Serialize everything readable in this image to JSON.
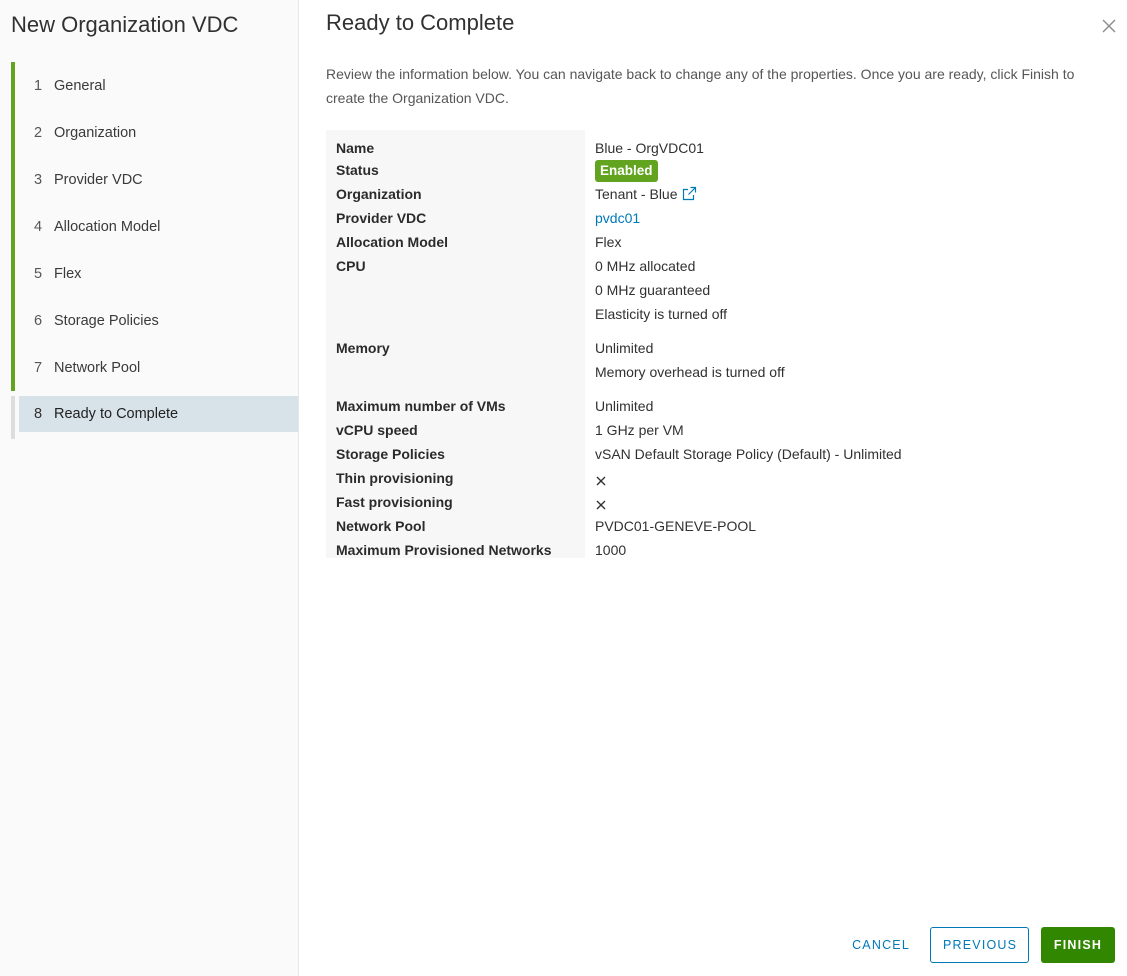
{
  "wizard": {
    "title": "New Organization VDC",
    "steps": [
      {
        "num": "1",
        "label": "General"
      },
      {
        "num": "2",
        "label": "Organization"
      },
      {
        "num": "3",
        "label": "Provider VDC"
      },
      {
        "num": "4",
        "label": "Allocation Model"
      },
      {
        "num": "5",
        "label": "Flex"
      },
      {
        "num": "6",
        "label": "Storage Policies"
      },
      {
        "num": "7",
        "label": "Network Pool"
      },
      {
        "num": "8",
        "label": "Ready to Complete"
      }
    ],
    "active_step": 8
  },
  "page": {
    "title": "Ready to Complete",
    "intro": "Review the information below. You can navigate back to change any of the properties. Once you are ready, click Finish to create the Organization VDC."
  },
  "summary": {
    "name": {
      "label": "Name",
      "value": "Blue - OrgVDC01"
    },
    "status": {
      "label": "Status",
      "value": "Enabled"
    },
    "organization": {
      "label": "Organization",
      "value": "Tenant - Blue"
    },
    "provider_vdc": {
      "label": "Provider VDC",
      "value": "pvdc01"
    },
    "allocation_model": {
      "label": "Allocation Model",
      "value": "Flex"
    },
    "cpu": {
      "label": "CPU",
      "lines": [
        "0 MHz allocated",
        "0 MHz guaranteed",
        "Elasticity is turned off"
      ]
    },
    "memory": {
      "label": "Memory",
      "lines": [
        "Unlimited",
        "Memory overhead is turned off"
      ]
    },
    "max_vms": {
      "label": "Maximum number of VMs",
      "value": "Unlimited"
    },
    "vcpu_speed": {
      "label": "vCPU speed",
      "value": "1 GHz per VM"
    },
    "storage_policies": {
      "label": "Storage Policies",
      "value": "vSAN Default Storage Policy (Default) - Unlimited"
    },
    "thin_provisioning": {
      "label": "Thin provisioning",
      "icon": "x-mark-icon"
    },
    "fast_provisioning": {
      "label": "Fast provisioning",
      "icon": "x-mark-icon"
    },
    "network_pool": {
      "label": "Network Pool",
      "value": "PVDC01-GENEVE-POOL"
    },
    "max_networks": {
      "label": "Maximum Provisioned Networks",
      "value": "1000"
    }
  },
  "footer": {
    "cancel": "CANCEL",
    "previous": "PREVIOUS",
    "finish": "FINISH"
  },
  "colors": {
    "accent": "#0079b8",
    "step_complete": "#62a420",
    "finish_bg": "#318700",
    "active_step_bg": "#d8e3e9"
  }
}
